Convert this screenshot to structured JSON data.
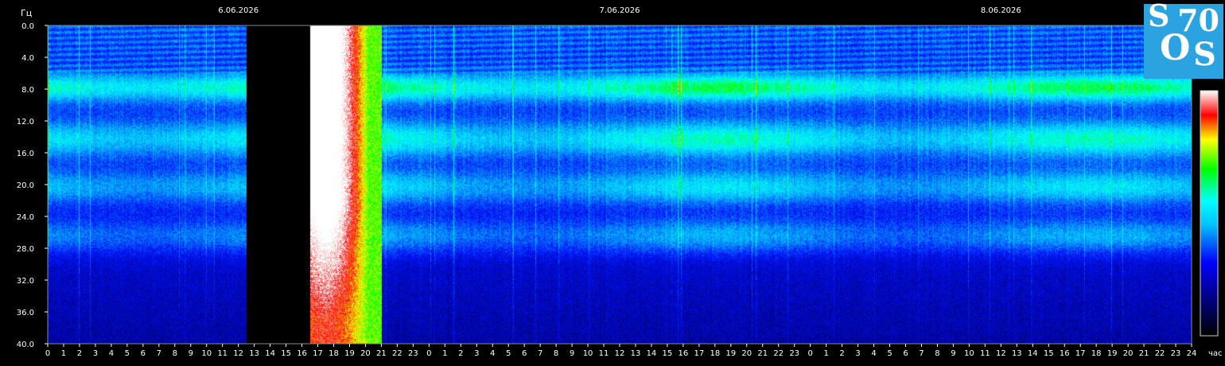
{
  "chart_data": {
    "type": "heatmap",
    "title": "",
    "ylabel": "Гц",
    "xlabel": "час",
    "ylim": [
      0,
      40
    ],
    "y_ticks": [
      "0.0",
      "4.0",
      "8.0",
      "12.0",
      "16.0",
      "20.0",
      "24.0",
      "28.0",
      "32.0",
      "36.0",
      "40.0"
    ],
    "dates": [
      "6.06.2026",
      "7.06.2026",
      "8.06.2026"
    ],
    "x_ticks": [
      "0",
      "1",
      "2",
      "3",
      "4",
      "5",
      "6",
      "7",
      "8",
      "9",
      "10",
      "11",
      "12",
      "13",
      "14",
      "15",
      "16",
      "17",
      "18",
      "19",
      "20",
      "21",
      "22",
      "23",
      "0",
      "1",
      "2",
      "3",
      "4",
      "5",
      "6",
      "7",
      "8",
      "9",
      "10",
      "11",
      "12",
      "13",
      "14",
      "15",
      "16",
      "17",
      "18",
      "19",
      "20",
      "21",
      "22",
      "23",
      "0",
      "1",
      "2",
      "3",
      "4",
      "5",
      "6",
      "7",
      "8",
      "9",
      "10",
      "11",
      "12",
      "13",
      "14",
      "15",
      "16",
      "17",
      "18",
      "19",
      "20",
      "21",
      "22",
      "23",
      "24"
    ],
    "x_range_hours": [
      0,
      72
    ],
    "no_data_hours": [
      12.5,
      16.5
    ],
    "bright_burst_hours": [
      14.7,
      21.0
    ],
    "resonance_bands_hz": [
      7.8,
      14.3,
      20.3,
      26.4
    ],
    "colorscale": [
      "#000000",
      "#000080",
      "#0000ff",
      "#00ffff",
      "#00ff00",
      "#ffff00",
      "#ff0000",
      "#ffffff"
    ]
  },
  "logo": {
    "letters": [
      "S",
      "70",
      "O",
      "S"
    ]
  }
}
